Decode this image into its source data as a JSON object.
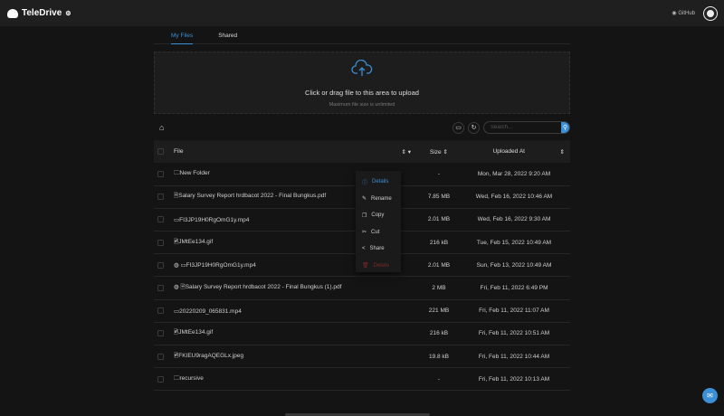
{
  "header": {
    "app_name": "TeleDrive",
    "github_label": "GitHub"
  },
  "tabs": [
    {
      "label": "My Files",
      "active": true
    },
    {
      "label": "Shared",
      "active": false
    }
  ],
  "upload": {
    "title": "Click or drag file to this area to upload",
    "subtitle": "Maximum file size is unlimited"
  },
  "toolbar": {
    "search_placeholder": "Search..."
  },
  "table": {
    "columns": [
      "File",
      "Size",
      "Uploaded At"
    ],
    "rows": [
      {
        "icon": "folder",
        "name": "New Folder",
        "size": "-",
        "date": "Mon, Mar 28, 2022 9:20 AM"
      },
      {
        "icon": "file",
        "name": "Salary Survey Report hrdbacot 2022 - Final Bungkus.pdf",
        "size": "7.85 MB",
        "date": "Wed, Feb 16, 2022 10:46 AM"
      },
      {
        "icon": "video",
        "name": "FI3JP19H0RgOmG1y.mp4",
        "size": "2.01 MB",
        "date": "Wed, Feb 16, 2022 9:30 AM"
      },
      {
        "icon": "image",
        "name": "JMtEe134.gif",
        "size": "216 kB",
        "date": "Tue, Feb 15, 2022 10:49 AM"
      },
      {
        "icon": "video",
        "shared": true,
        "name": "FI3JP19H0RgOmG1y.mp4",
        "size": "2.01 MB",
        "date": "Sun, Feb 13, 2022 10:49 AM"
      },
      {
        "icon": "file",
        "shared": true,
        "name": "Salary Survey Report hrdbacot 2022 - Final Bungkus (1).pdf",
        "size": "2 MB",
        "date": "Fri, Feb 11, 2022 6:49 PM"
      },
      {
        "icon": "video",
        "name": "20220209_065831.mp4",
        "size": "221 MB",
        "date": "Fri, Feb 11, 2022 11:07 AM"
      },
      {
        "icon": "image",
        "name": "JMtEe134.gif",
        "size": "216 kB",
        "date": "Fri, Feb 11, 2022 10:51 AM"
      },
      {
        "icon": "image",
        "name": "FKIEU9ragAQEGLx.jpeg",
        "size": "19.8 kB",
        "date": "Fri, Feb 11, 2022 10:44 AM"
      },
      {
        "icon": "folder",
        "name": "recursive",
        "size": "-",
        "date": "Fri, Feb 11, 2022 10:13 AM"
      }
    ]
  },
  "context_menu": [
    {
      "label": "Details",
      "icon": "info",
      "color": "#3b8fd6"
    },
    {
      "label": "Rename",
      "icon": "edit",
      "color": "#cfcfcf"
    },
    {
      "label": "Copy",
      "icon": "copy",
      "color": "#cfcfcf"
    },
    {
      "label": "Cut",
      "icon": "scissors",
      "color": "#cfcfcf"
    },
    {
      "label": "Share",
      "icon": "share",
      "color": "#cfcfcf"
    },
    {
      "label": "Delete",
      "icon": "trash",
      "color": "#7a2a2a"
    }
  ],
  "colors": {
    "accent": "#3b8fd6",
    "background": "#141414"
  }
}
